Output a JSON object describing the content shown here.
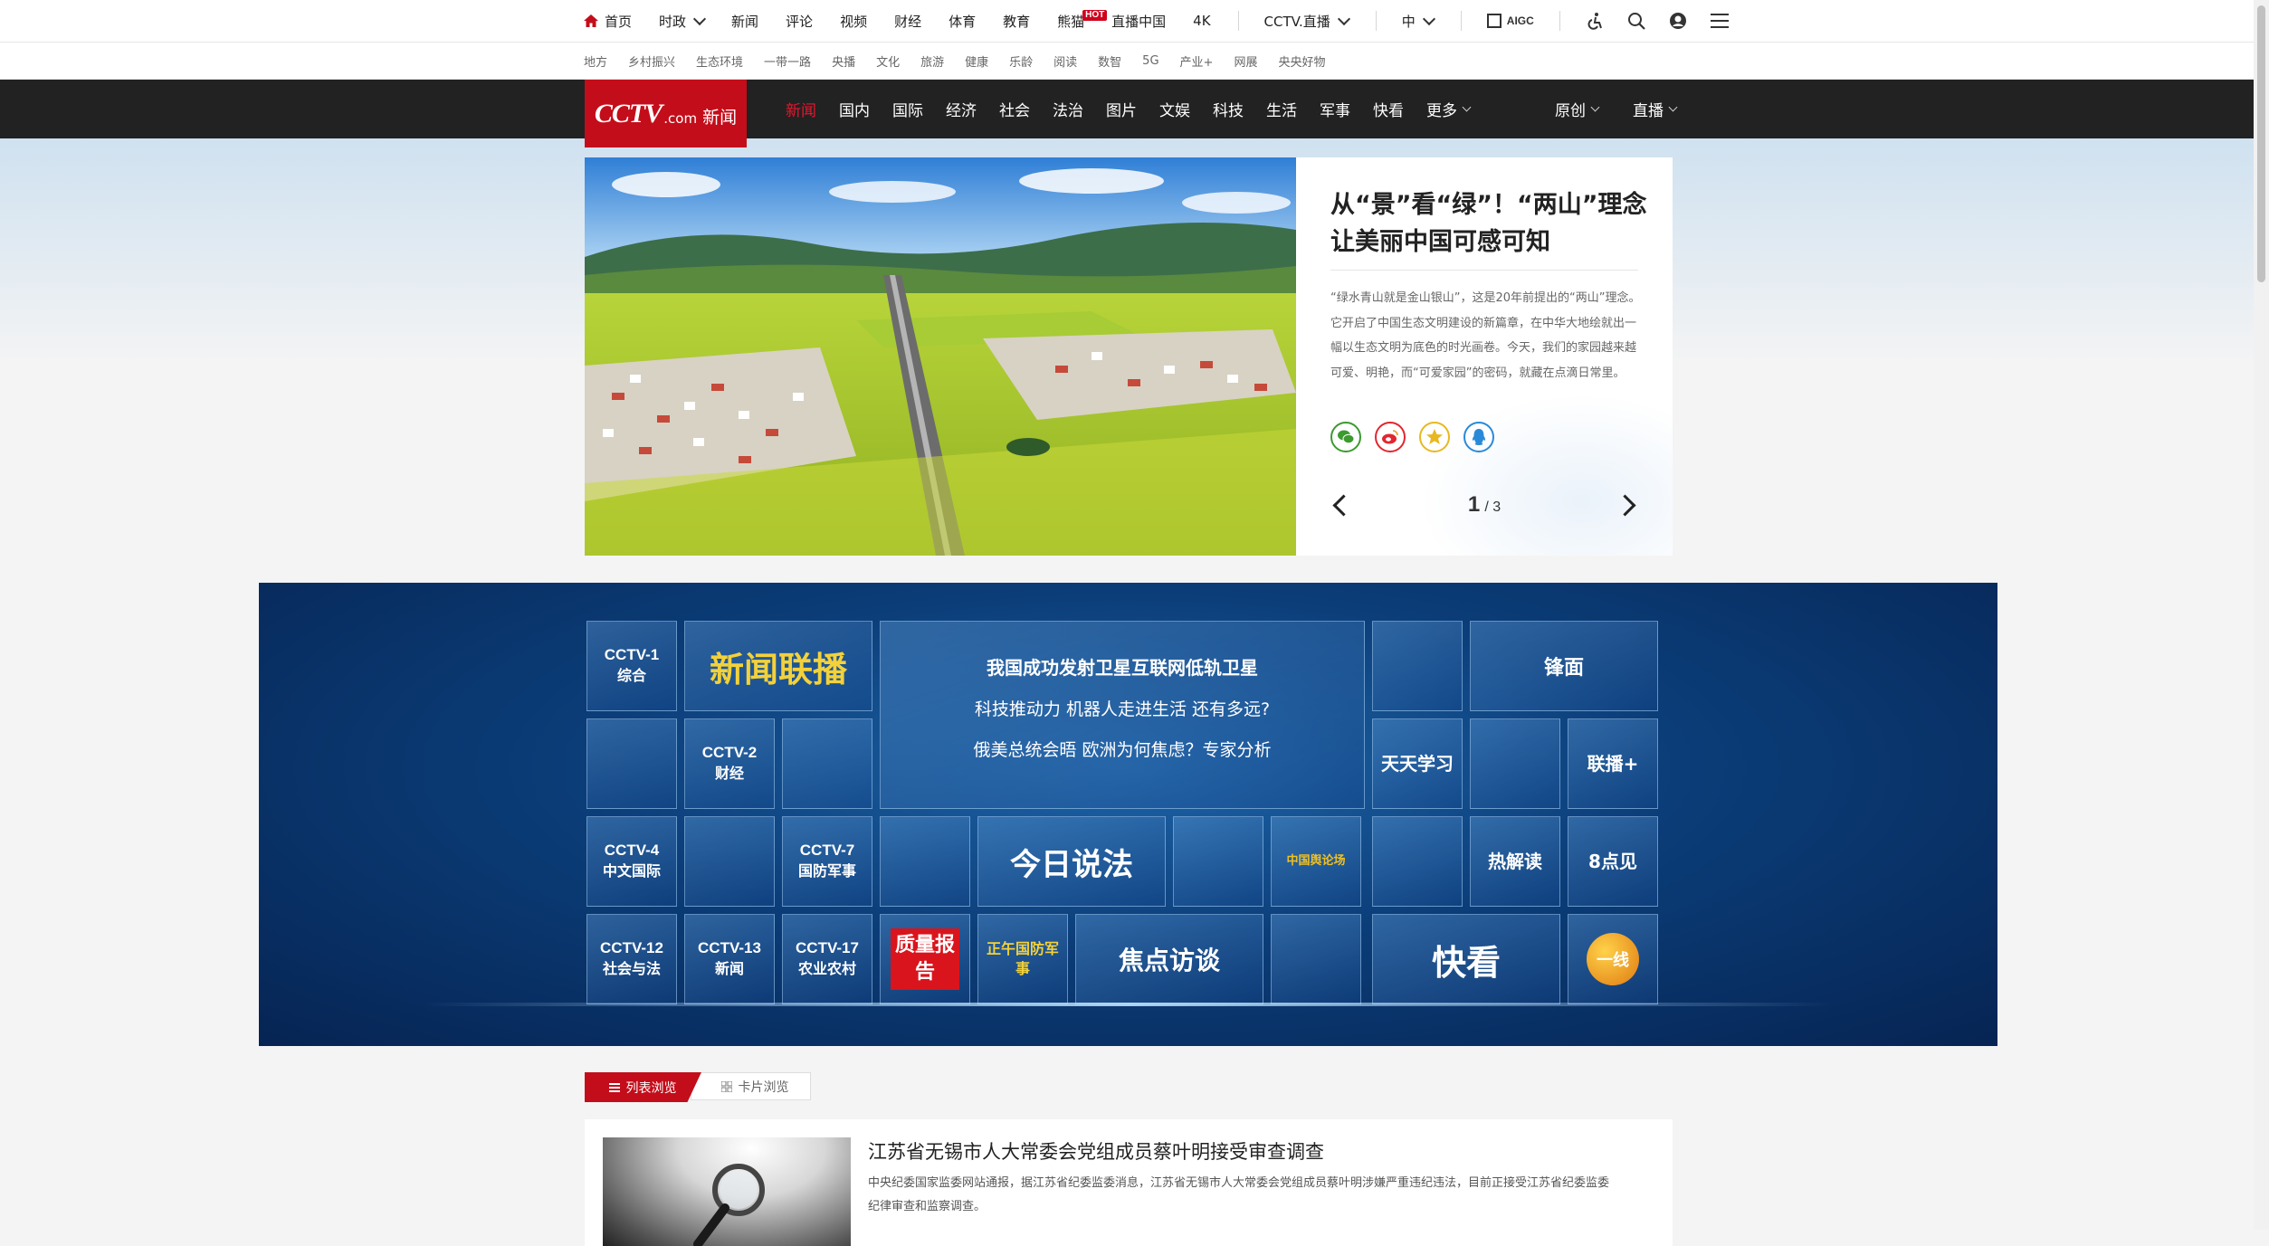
{
  "top_nav": {
    "home": "首页",
    "items": [
      "时政",
      "新闻",
      "评论",
      "视频",
      "财经",
      "体育",
      "教育",
      "熊猫",
      "直播中国",
      "4K"
    ],
    "hot_badge": "HOT",
    "live": "CCTV.直播",
    "lang": "中",
    "aigc": "AIGC"
  },
  "sub_nav": [
    "地方",
    "乡村振兴",
    "生态环境",
    "一带一路",
    "央播",
    "文化",
    "旅游",
    "健康",
    "乐龄",
    "阅读",
    "数智",
    "5G",
    "产业+",
    "网展",
    "央央好物"
  ],
  "logo": {
    "brand": "CCTV",
    "com": ".com",
    "section": "新闻"
  },
  "main_nav": {
    "items": [
      "新闻",
      "国内",
      "国际",
      "经济",
      "社会",
      "法治",
      "图片",
      "文娱",
      "科技",
      "生活",
      "军事",
      "快看"
    ],
    "more": "更多",
    "right": [
      "原创",
      "直播"
    ],
    "active_color": "#e6162d"
  },
  "hero": {
    "title": "从“景”看“绿”！“两山”理念让美丽中国可感可知",
    "summary": "“绿水青山就是金山银山”，这是20年前提出的“两山”理念。它开启了中国生态文明建设的新篇章，在中华大地绘就出一幅以生态文明为底色的时光画卷。今天，我们的家园越来越可爱、明艳，而“可爱家园”的密码，就藏在点滴日常里。",
    "share_icons": [
      "wechat-icon",
      "weibo-icon",
      "qzone-icon",
      "qq-icon"
    ],
    "page_current": "1",
    "page_total": "/ 3"
  },
  "tv": {
    "cctv1": [
      "CCTV-1",
      "综合"
    ],
    "xwlb": "新闻联播",
    "feature": [
      "我国成功发射卫星互联网低轨卫星",
      "科技推动力 机器人走进生活 还有多远?",
      "俄美总统会晤 欧洲为何焦虑？专家分析"
    ],
    "fengmian": "锋面",
    "cctv2": [
      "CCTV-2",
      "财经"
    ],
    "tiantian": "天天学习",
    "lianbo": "联播+",
    "cctv4": [
      "CCTV-4",
      "中文国际"
    ],
    "cctv7": [
      "CCTV-7",
      "国防军事"
    ],
    "jinri": "今日说法",
    "luntan": "中国舆论场",
    "rejiedu": "热解读",
    "badian": "8点见",
    "cctv12": [
      "CCTV-12",
      "社会与法"
    ],
    "cctv13": [
      "CCTV-13",
      "新闻"
    ],
    "cctv17": [
      "CCTV-17",
      "农业农村"
    ],
    "zhiliang": "质量报告",
    "junshi": "正午国防军事",
    "jiaodian": "焦点访谈",
    "kuaikan": "快看",
    "yixian": "一线"
  },
  "view_tabs": {
    "list": "列表浏览",
    "card": "卡片浏览"
  },
  "news": {
    "title": "江苏省无锡市人大常委会党组成员蔡叶明接受审查调查",
    "summary": "中央纪委国家监委网站通报，据江苏省纪委监委消息，江苏省无锡市人大常委会党组成员蔡叶明涉嫌严重违纪违法，目前正接受江苏省纪委监委纪律审查和监察调查。"
  }
}
